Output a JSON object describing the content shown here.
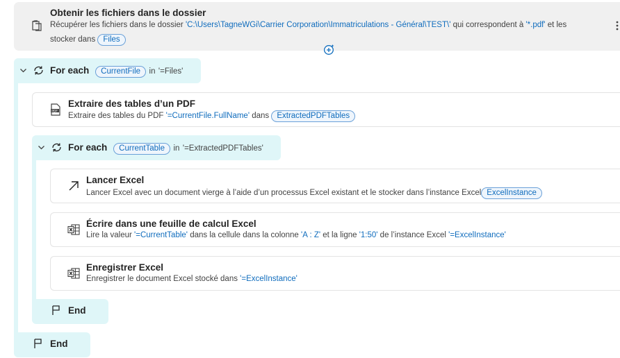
{
  "get_files": {
    "title": "Obtenir les fichiers dans le dossier",
    "desc_prefix": "Récupérer les fichiers dans le dossier ",
    "folder": "'C:\\Users\\TagneWGi\\Carrier Corporation\\Immatriculations - Général\\TEST\\'",
    "desc_mid": " qui correspondent à ",
    "pattern": "'*.pdf'",
    "desc_suffix": " et les",
    "desc_line2": "stocker dans ",
    "var": "Files",
    "more_icon": "more-vertical-icon",
    "add_icon": "add-action-icon"
  },
  "loop1": {
    "keyword": "For each",
    "var": "CurrentFile",
    "in": "in",
    "source": "'=Files'",
    "end_label": "End"
  },
  "extract_pdf": {
    "title": "Extraire des tables d’un PDF",
    "desc_prefix": "Extraire des tables du PDF ",
    "source": "'=CurrentFile.FullName'",
    "desc_mid": " dans ",
    "var": "ExtractedPDFTables"
  },
  "loop2": {
    "keyword": "For each",
    "var": "CurrentTable",
    "in": "in",
    "source": "'=ExtractedPDFTables'",
    "end_label": "End"
  },
  "launch_excel": {
    "title": "Lancer Excel",
    "desc": "Lancer Excel avec un document vierge à l’aide d’un processus Excel existant et le stocker dans l’instance Excel",
    "var": "ExcelInstance"
  },
  "write_excel": {
    "title": "Écrire dans une feuille de calcul Excel",
    "desc_1": "Lire la valeur ",
    "value": "'=CurrentTable'",
    "desc_2": " dans la cellule dans la colonne ",
    "col": "'A : Z'",
    "desc_3": " et la ligne ",
    "row": "'1:50'",
    "desc_4": " de l’instance Excel ",
    "instance": "'=ExcelInstance'"
  },
  "save_excel": {
    "title": "Enregistrer Excel",
    "desc_1": "Enregistrer le document Excel stocké dans ",
    "instance": "'=ExcelInstance'"
  }
}
